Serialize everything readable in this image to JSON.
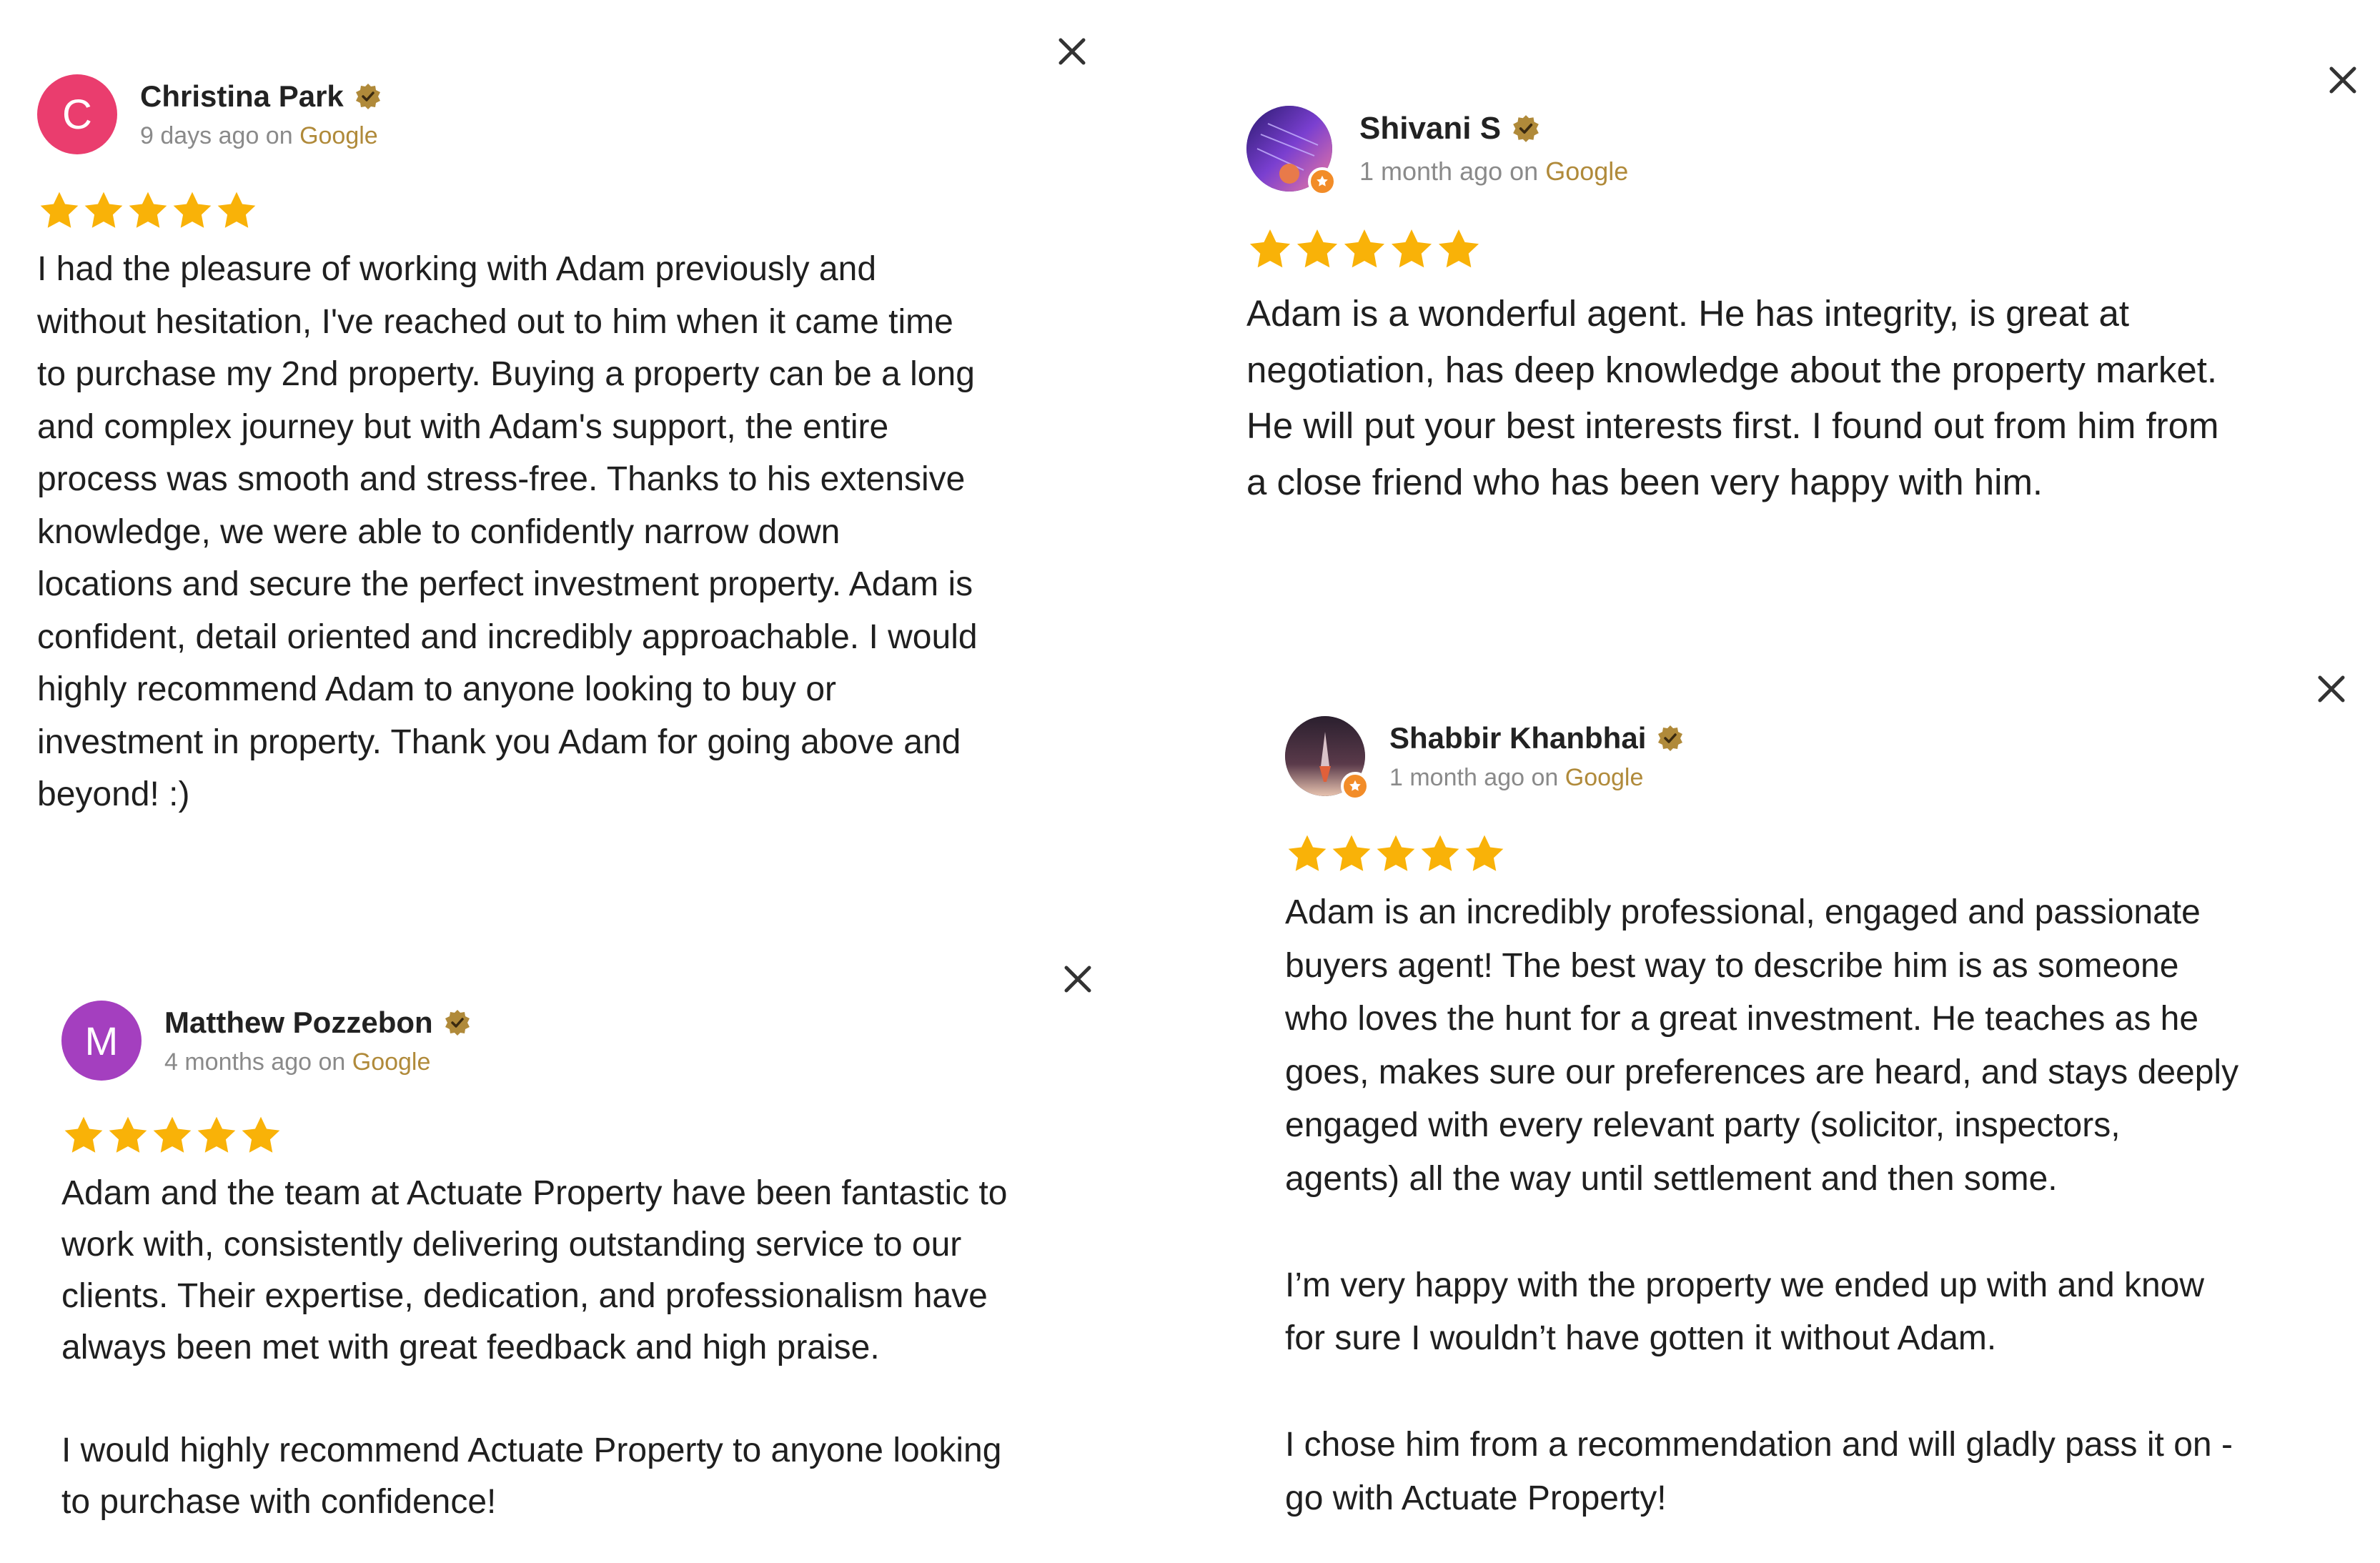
{
  "colors": {
    "star": "#f9b208",
    "source_link": "#b08a3a",
    "meta_text": "#8a8a8a",
    "verified_badge": "#b08a3a"
  },
  "reviews": [
    {
      "author": "Christina Park",
      "avatar_initial": "C",
      "avatar_color": "#ea3d6e",
      "time_prefix": "9 days ago on ",
      "source": "Google",
      "rating": 5,
      "text": "I had the pleasure of working with Adam previously and\nwithout hesitation, I've reached out to him when it came time\nto purchase my 2nd property. Buying a property can be a long\nand complex journey but with Adam's support, the entire\nprocess was smooth and stress-free. Thanks to his extensive\nknowledge, we were able to confidently narrow down\nlocations and secure the perfect investment property. Adam is\nconfident, detail oriented and incredibly approachable. I would\nhighly recommend Adam to anyone looking to buy or\ninvestment in property. Thank you Adam for going above and\nbeyond! :)"
    },
    {
      "author": "Shivani S",
      "avatar_initial": "",
      "avatar_color": "#4a2a9a",
      "time_prefix": "1 month ago on ",
      "source": "Google",
      "rating": 5,
      "text": "Adam is a wonderful agent. He has integrity, is great at\nnegotiation, has deep knowledge about the property market.\nHe will put your best interests first. I found out from him from\na close friend who has been very happy with him."
    },
    {
      "author": "Matthew Pozzebon",
      "avatar_initial": "M",
      "avatar_color": "#a43fbf",
      "time_prefix": "4 months ago on ",
      "source": "Google",
      "rating": 5,
      "text": "Adam and the team at Actuate Property have been fantastic to\nwork with, consistently delivering outstanding service to our\nclients. Their expertise, dedication, and professionalism have\nalways been met with great feedback and high praise.\n\nI would highly recommend Actuate Property to anyone looking\nto purchase with confidence!"
    },
    {
      "author": "Shabbir Khanbhai",
      "avatar_initial": "",
      "avatar_color": "#3a2a3a",
      "time_prefix": "1 month ago on ",
      "source": "Google",
      "rating": 5,
      "text": "Adam is an incredibly professional, engaged and passionate\nbuyers agent! The best way to describe him is as someone\nwho loves the hunt for a great investment. He teaches as he\ngoes, makes sure our preferences are heard, and stays deeply\nengaged with every relevant party (solicitor, inspectors,\nagents) all the way until settlement and then some.\n\nI’m very happy with the property we ended up with and know\nfor sure I wouldn’t have gotten it without Adam.\n\nI chose him from a recommendation and will gladly pass it on -\ngo with Actuate Property!"
    }
  ]
}
